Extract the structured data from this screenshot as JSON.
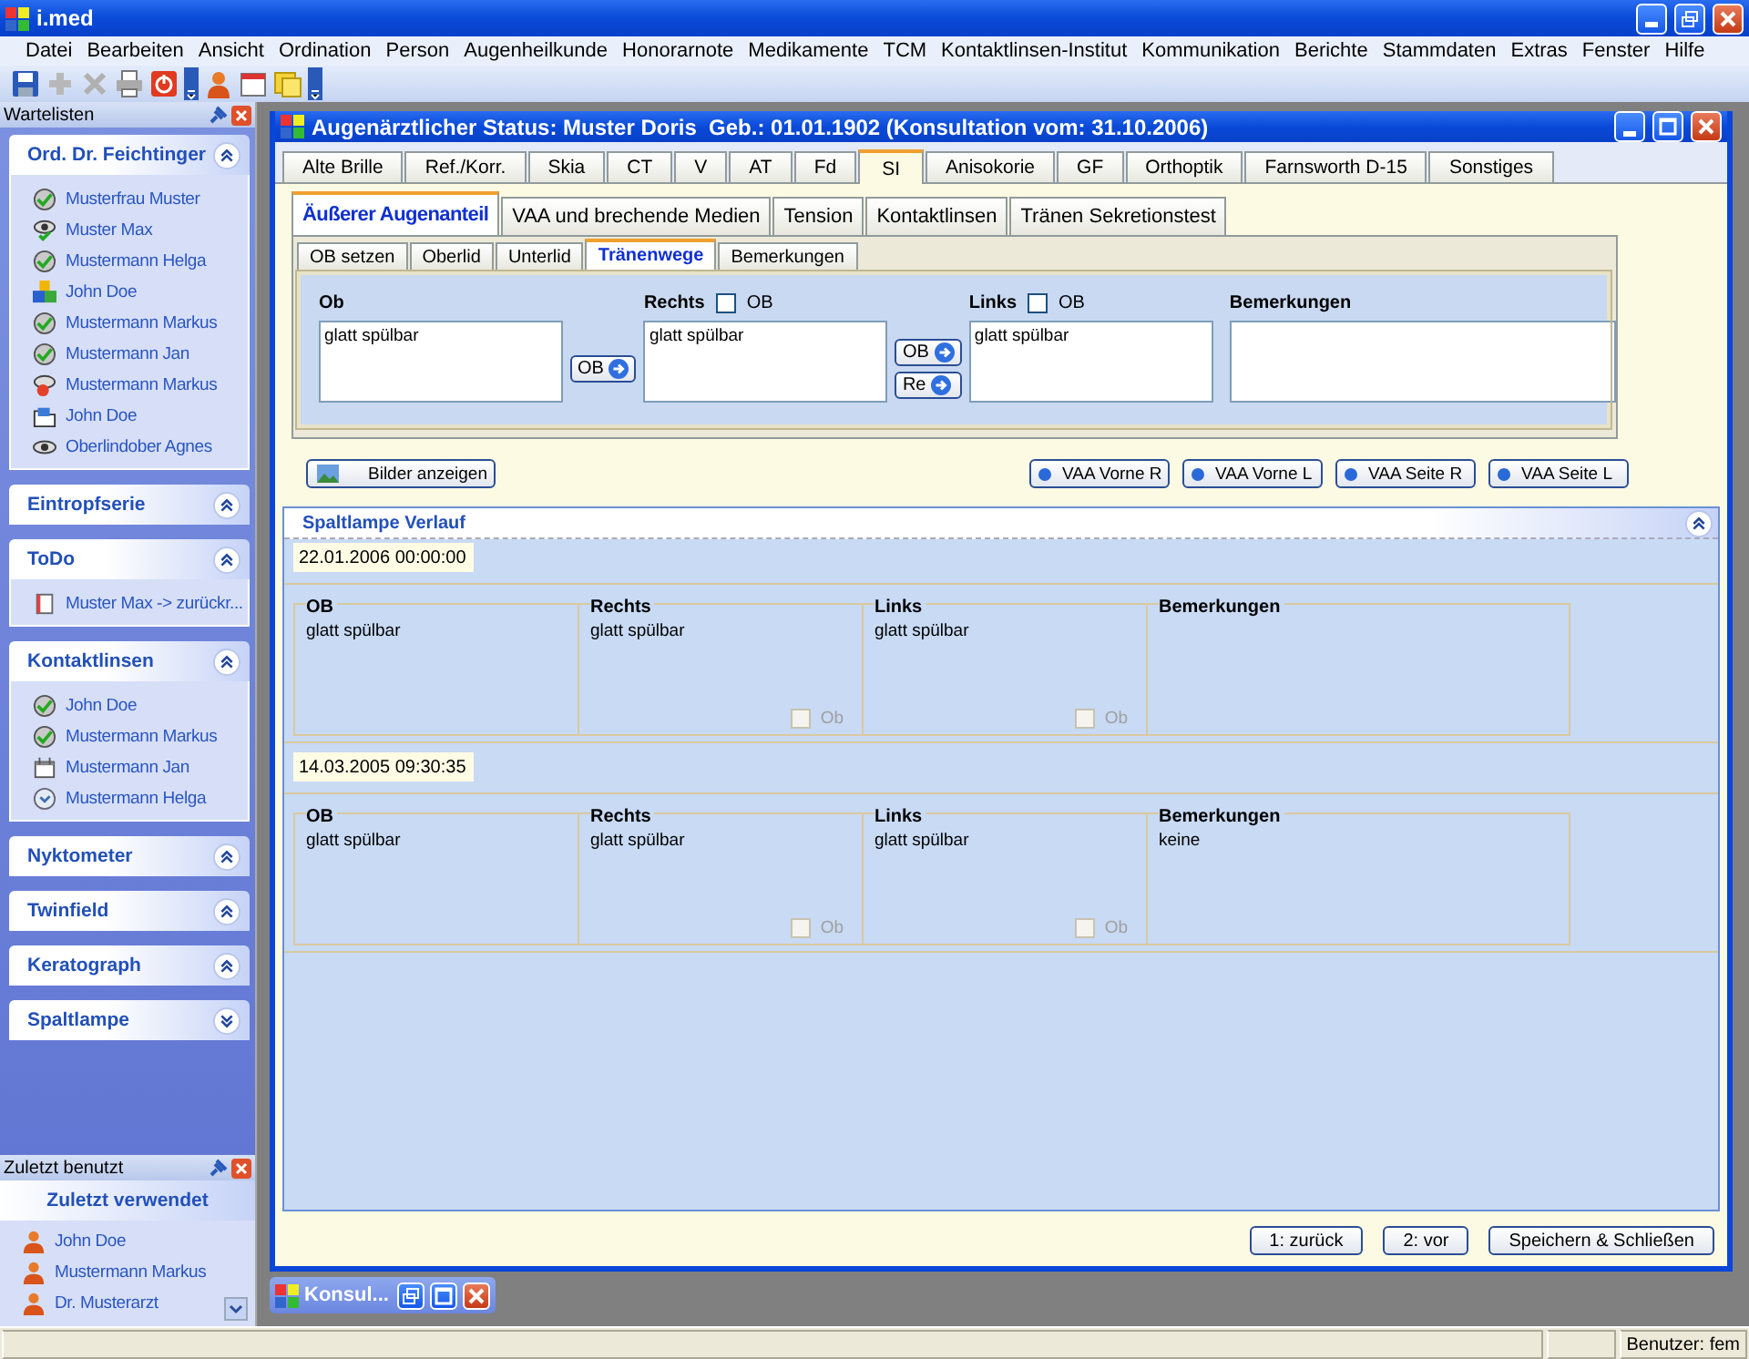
{
  "app": {
    "title": "i.med"
  },
  "menu": [
    "Datei",
    "Bearbeiten",
    "Ansicht",
    "Ordination",
    "Person",
    "Augenheilkunde",
    "Honorarnote",
    "Medikamente",
    "TCM",
    "Kontaktlinsen-Institut",
    "Kommunikation",
    "Berichte",
    "Stammdaten",
    "Extras",
    "Fenster",
    "Hilfe"
  ],
  "sidebar": {
    "title": "Wartelisten",
    "groups": [
      {
        "title": "Ord. Dr. Feichtinger",
        "expanded": true,
        "items": [
          {
            "label": "Musterfrau Muster",
            "kind": "check"
          },
          {
            "label": "Muster Max",
            "kind": "eyecheck"
          },
          {
            "label": "Mustermann Helga",
            "kind": "check"
          },
          {
            "label": "John Doe",
            "kind": "blocks"
          },
          {
            "label": "Mustermann Markus",
            "kind": "check"
          },
          {
            "label": "Mustermann Jan",
            "kind": "check"
          },
          {
            "label": "Mustermann Markus",
            "kind": "alert"
          },
          {
            "label": "John Doe",
            "kind": "folder"
          },
          {
            "label": "Oberlindober Agnes",
            "kind": "eye"
          }
        ]
      },
      {
        "title": "Eintropfserie",
        "expanded": true
      },
      {
        "title": "ToDo",
        "expanded": true,
        "items": [
          {
            "label": "Muster Max -> zurückr...",
            "kind": "document"
          }
        ]
      },
      {
        "title": "Kontaktlinsen",
        "expanded": true,
        "items": [
          {
            "label": "John Doe",
            "kind": "check"
          },
          {
            "label": "Mustermann Markus",
            "kind": "check"
          },
          {
            "label": "Mustermann Jan",
            "kind": "calendar"
          },
          {
            "label": "Mustermann Helga",
            "kind": "clock"
          }
        ]
      },
      {
        "title": "Nyktometer",
        "expanded": true
      },
      {
        "title": "Twinfield",
        "expanded": true
      },
      {
        "title": "Keratograph",
        "expanded": true
      },
      {
        "title": "Spaltlampe",
        "expanded": false
      }
    ]
  },
  "recent": {
    "title": "Zuletzt benutzt",
    "heading": "Zuletzt verwendet",
    "items": [
      "John Doe",
      "Mustermann Markus",
      "Dr. Musterarzt"
    ]
  },
  "child": {
    "title": "Augenärztlicher Status: Muster Doris  Geb.: 01.01.1902 (Konsultation vom: 31.10.2006)",
    "tabs": [
      {
        "label": "Alte Brille",
        "selected": false
      },
      {
        "label": "Ref./Korr.",
        "selected": false
      },
      {
        "label": "Skia",
        "selected": false
      },
      {
        "label": "CT",
        "selected": false
      },
      {
        "label": "V",
        "selected": false
      },
      {
        "label": "AT",
        "selected": false
      },
      {
        "label": "Fd",
        "selected": false
      },
      {
        "label": "SI",
        "selected": true
      },
      {
        "label": "Anisokorie",
        "selected": false
      },
      {
        "label": "GF",
        "selected": false
      },
      {
        "label": "Orthoptik",
        "selected": false
      },
      {
        "label": "Farnsworth D-15",
        "selected": false
      },
      {
        "label": "Sonstiges",
        "selected": false
      }
    ],
    "subtabs": [
      {
        "label": "Äußerer Augenanteil",
        "selected": true
      },
      {
        "label": "VAA und brechende Medien",
        "selected": false
      },
      {
        "label": "Tension",
        "selected": false
      },
      {
        "label": "Kontaktlinsen",
        "selected": false
      },
      {
        "label": "Tränen Sekretionstest",
        "selected": false
      }
    ],
    "subsubtabs": [
      {
        "label": "OB setzen",
        "selected": false
      },
      {
        "label": "Oberlid",
        "selected": false
      },
      {
        "label": "Unterlid",
        "selected": false
      },
      {
        "label": "Tränenwege",
        "selected": true
      },
      {
        "label": "Bemerkungen",
        "selected": false
      }
    ],
    "form": {
      "ob": {
        "label": "Ob",
        "value": "glatt spülbar"
      },
      "ob_button": "OB",
      "rechts": {
        "label": "Rechts",
        "check_label": "OB",
        "checked": false,
        "value": "glatt spülbar"
      },
      "copy_buttons": [
        "OB",
        "Re"
      ],
      "links": {
        "label": "Links",
        "check_label": "OB",
        "checked": false,
        "value": "glatt spülbar"
      },
      "bemerkungen": {
        "label": "Bemerkungen"
      }
    },
    "bilder_button": "Bilder anzeigen",
    "vaa_buttons": [
      "VAA Vorne R",
      "VAA Vorne L",
      "VAA Seite R",
      "VAA Seite L"
    ],
    "history": {
      "title": "Spaltlampe Verlauf",
      "expanded": true,
      "entries": [
        {
          "timestamp": "22.01.2006 00:00:00",
          "fields": [
            {
              "label": "OB",
              "value": "glatt spülbar"
            },
            {
              "label": "Rechts",
              "value": "glatt spülbar",
              "check_label": "Ob",
              "checked": false,
              "disabled": true
            },
            {
              "label": "Links",
              "value": "glatt spülbar",
              "check_label": "Ob",
              "checked": false,
              "disabled": true
            },
            {
              "label": "Bemerkungen"
            }
          ]
        },
        {
          "timestamp": "14.03.2005 09:30:35",
          "fields": [
            {
              "label": "OB",
              "value": "glatt spülbar"
            },
            {
              "label": "Rechts",
              "value": "glatt spülbar",
              "check_label": "Ob",
              "checked": false,
              "disabled": true
            },
            {
              "label": "Links",
              "value": "glatt spülbar",
              "check_label": "Ob",
              "checked": false,
              "disabled": true
            },
            {
              "label": "Bemerkungen",
              "value": "keine"
            }
          ]
        }
      ]
    },
    "footer_buttons": [
      "1: zurück",
      "2: vor",
      "Speichern & Schließen"
    ]
  },
  "minimized": {
    "title": "Konsul..."
  },
  "status_bar": {
    "user": "Benutzer: fem"
  }
}
